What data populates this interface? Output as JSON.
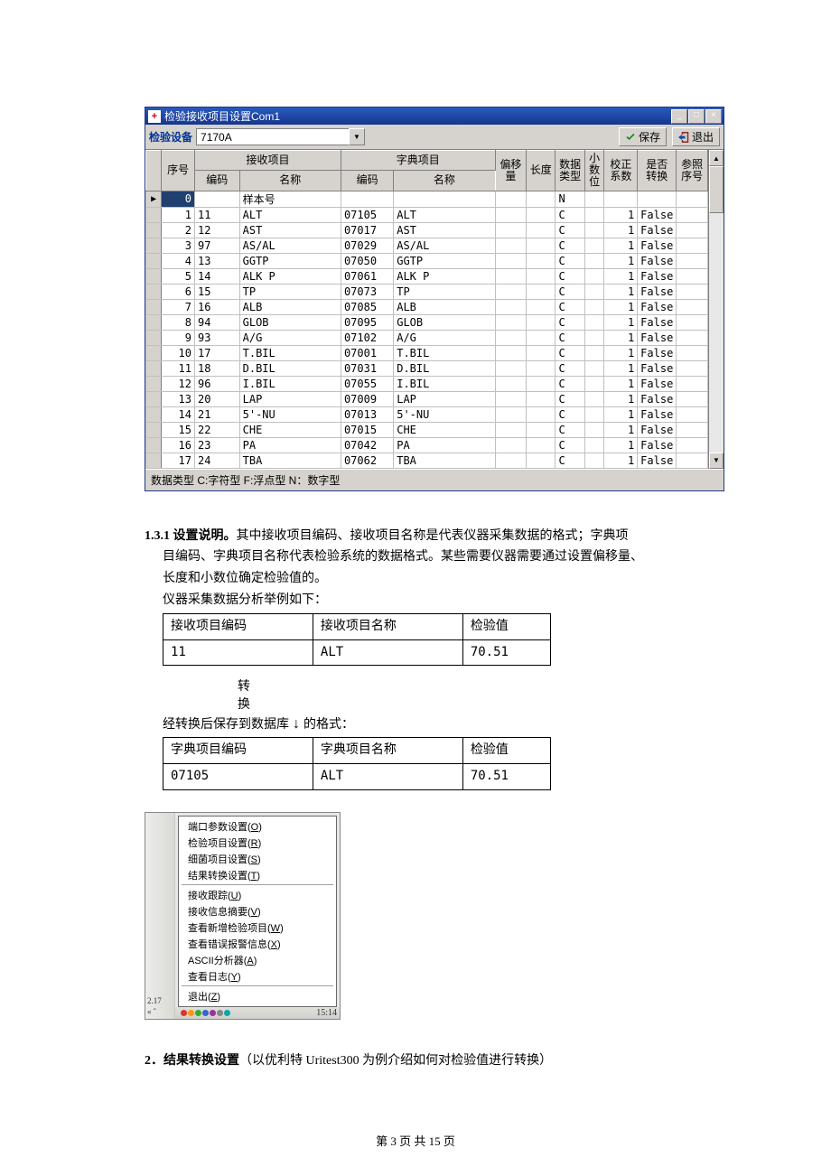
{
  "window": {
    "title": "检验接收项目设置Com1",
    "device_label": "检验设备",
    "device_value": "7170A",
    "save_label": "保存",
    "exit_label": "退出",
    "head_group_recv": "接收项目",
    "head_group_dict": "字典项目",
    "col_seq": "序号",
    "col_code": "编码",
    "col_name": "名称",
    "col_offset": "偏移\n量",
    "col_len": "长度",
    "col_dtype": "数据\n类型",
    "col_dec": "小\n数\n位",
    "col_factor": "校正\n系数",
    "col_conv": "是否\n转换",
    "col_ref": "参照\n序号",
    "status": "数据类型   C:字符型   F:浮点型   N：数字型"
  },
  "rows": [
    {
      "seq": "0",
      "rcode": "",
      "rname": "样本号",
      "dcode": "",
      "dname": "",
      "off": "",
      "len": "",
      "dt": "N",
      "dec": "",
      "fac": "",
      "conv": "",
      "ref": ""
    },
    {
      "seq": "1",
      "rcode": "11",
      "rname": "ALT",
      "dcode": "07105",
      "dname": "ALT",
      "off": "",
      "len": "",
      "dt": "C",
      "dec": "",
      "fac": "1",
      "conv": "False",
      "ref": ""
    },
    {
      "seq": "2",
      "rcode": "12",
      "rname": "AST",
      "dcode": "07017",
      "dname": "AST",
      "off": "",
      "len": "",
      "dt": "C",
      "dec": "",
      "fac": "1",
      "conv": "False",
      "ref": ""
    },
    {
      "seq": "3",
      "rcode": "97",
      "rname": "AS/AL",
      "dcode": "07029",
      "dname": "AS/AL",
      "off": "",
      "len": "",
      "dt": "C",
      "dec": "",
      "fac": "1",
      "conv": "False",
      "ref": ""
    },
    {
      "seq": "4",
      "rcode": "13",
      "rname": "GGTP",
      "dcode": "07050",
      "dname": "GGTP",
      "off": "",
      "len": "",
      "dt": "C",
      "dec": "",
      "fac": "1",
      "conv": "False",
      "ref": ""
    },
    {
      "seq": "5",
      "rcode": "14",
      "rname": "ALK P",
      "dcode": "07061",
      "dname": "ALK P",
      "off": "",
      "len": "",
      "dt": "C",
      "dec": "",
      "fac": "1",
      "conv": "False",
      "ref": ""
    },
    {
      "seq": "6",
      "rcode": "15",
      "rname": "TP",
      "dcode": "07073",
      "dname": "TP",
      "off": "",
      "len": "",
      "dt": "C",
      "dec": "",
      "fac": "1",
      "conv": "False",
      "ref": ""
    },
    {
      "seq": "7",
      "rcode": "16",
      "rname": "ALB",
      "dcode": "07085",
      "dname": "ALB",
      "off": "",
      "len": "",
      "dt": "C",
      "dec": "",
      "fac": "1",
      "conv": "False",
      "ref": ""
    },
    {
      "seq": "8",
      "rcode": "94",
      "rname": "GLOB",
      "dcode": "07095",
      "dname": "GLOB",
      "off": "",
      "len": "",
      "dt": "C",
      "dec": "",
      "fac": "1",
      "conv": "False",
      "ref": ""
    },
    {
      "seq": "9",
      "rcode": "93",
      "rname": "A/G",
      "dcode": "07102",
      "dname": "A/G",
      "off": "",
      "len": "",
      "dt": "C",
      "dec": "",
      "fac": "1",
      "conv": "False",
      "ref": ""
    },
    {
      "seq": "10",
      "rcode": "17",
      "rname": "T.BIL",
      "dcode": "07001",
      "dname": "T.BIL",
      "off": "",
      "len": "",
      "dt": "C",
      "dec": "",
      "fac": "1",
      "conv": "False",
      "ref": ""
    },
    {
      "seq": "11",
      "rcode": "18",
      "rname": "D.BIL",
      "dcode": "07031",
      "dname": "D.BIL",
      "off": "",
      "len": "",
      "dt": "C",
      "dec": "",
      "fac": "1",
      "conv": "False",
      "ref": ""
    },
    {
      "seq": "12",
      "rcode": "96",
      "rname": "I.BIL",
      "dcode": "07055",
      "dname": "I.BIL",
      "off": "",
      "len": "",
      "dt": "C",
      "dec": "",
      "fac": "1",
      "conv": "False",
      "ref": ""
    },
    {
      "seq": "13",
      "rcode": "20",
      "rname": "LAP",
      "dcode": "07009",
      "dname": "LAP",
      "off": "",
      "len": "",
      "dt": "C",
      "dec": "",
      "fac": "1",
      "conv": "False",
      "ref": ""
    },
    {
      "seq": "14",
      "rcode": "21",
      "rname": "5'-NU",
      "dcode": "07013",
      "dname": "5'-NU",
      "off": "",
      "len": "",
      "dt": "C",
      "dec": "",
      "fac": "1",
      "conv": "False",
      "ref": ""
    },
    {
      "seq": "15",
      "rcode": "22",
      "rname": "CHE",
      "dcode": "07015",
      "dname": "CHE",
      "off": "",
      "len": "",
      "dt": "C",
      "dec": "",
      "fac": "1",
      "conv": "False",
      "ref": ""
    },
    {
      "seq": "16",
      "rcode": "23",
      "rname": "PA",
      "dcode": "07042",
      "dname": "PA",
      "off": "",
      "len": "",
      "dt": "C",
      "dec": "",
      "fac": "1",
      "conv": "False",
      "ref": ""
    },
    {
      "seq": "17",
      "rcode": "24",
      "rname": "TBA",
      "dcode": "07062",
      "dname": "TBA",
      "off": "",
      "len": "",
      "dt": "C",
      "dec": "",
      "fac": "1",
      "conv": "False",
      "ref": ""
    }
  ],
  "sec131": {
    "head": "1.3.1 设置说明。",
    "line1": "其中接收项目编码、接收项目名称是代表仪器采集数据的格式；字典项",
    "line2": "目编码、字典项目名称代表检验系统的数据格式。某些需要仪器需要通过设置偏移量、",
    "line3": "长度和小数位确定检验值的。",
    "line4": "仪器采集数据分析举例如下："
  },
  "table1": {
    "h1": "接收项目编码",
    "h2": "接收项目名称",
    "h3": "检验值",
    "c1": "11",
    "c2": "ALT",
    "c3": "70.51"
  },
  "conv": {
    "t1": "转",
    "t2": "换",
    "line": "经转换后保存到数据库",
    "tail": "的格式："
  },
  "table2": {
    "h1": "字典项目编码",
    "h2": "字典项目名称",
    "h3": "检验值",
    "c1": "07105",
    "c2": "ALT",
    "c3": "70.51"
  },
  "ctx": {
    "items1": [
      "端口参数设置(O)",
      "检验项目设置(R)",
      "细菌项目设置(S)",
      "结果转换设置(T)"
    ],
    "items2": [
      "接收跟踪(U)",
      "接收信息摘要(V)",
      "查看新增检验项目(W)",
      "查看错误报警信息(X)",
      "ASCII分析器(A)",
      "查看日志(Y)"
    ],
    "items3": [
      "退出(Z)"
    ],
    "side_num": "2.17",
    "side_chev": "« ˆ",
    "time": "15:14"
  },
  "sec2": {
    "head": "2．结果转换设置",
    "rest": "（以优利特 Uritest300 为例介绍如何对检验值进行转换）"
  },
  "footer": "第 3 页 共 15 页"
}
